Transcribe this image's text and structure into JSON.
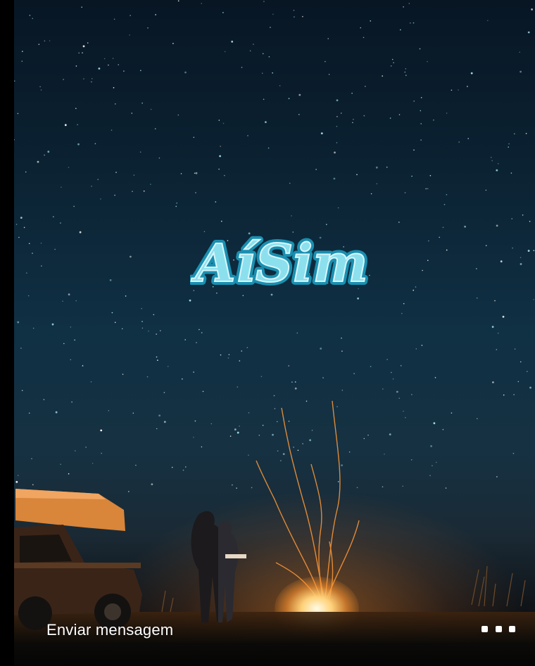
{
  "story": {
    "logo_text": "AíSim",
    "message_placeholder": "Enviar mensagem",
    "more_icon": "ellipsis-icon"
  },
  "colors": {
    "logo_fill": "#8ce0ee",
    "logo_outline": "#1a8fb0",
    "sky_top": "#081624",
    "fire_glow": "#ffd27a"
  }
}
